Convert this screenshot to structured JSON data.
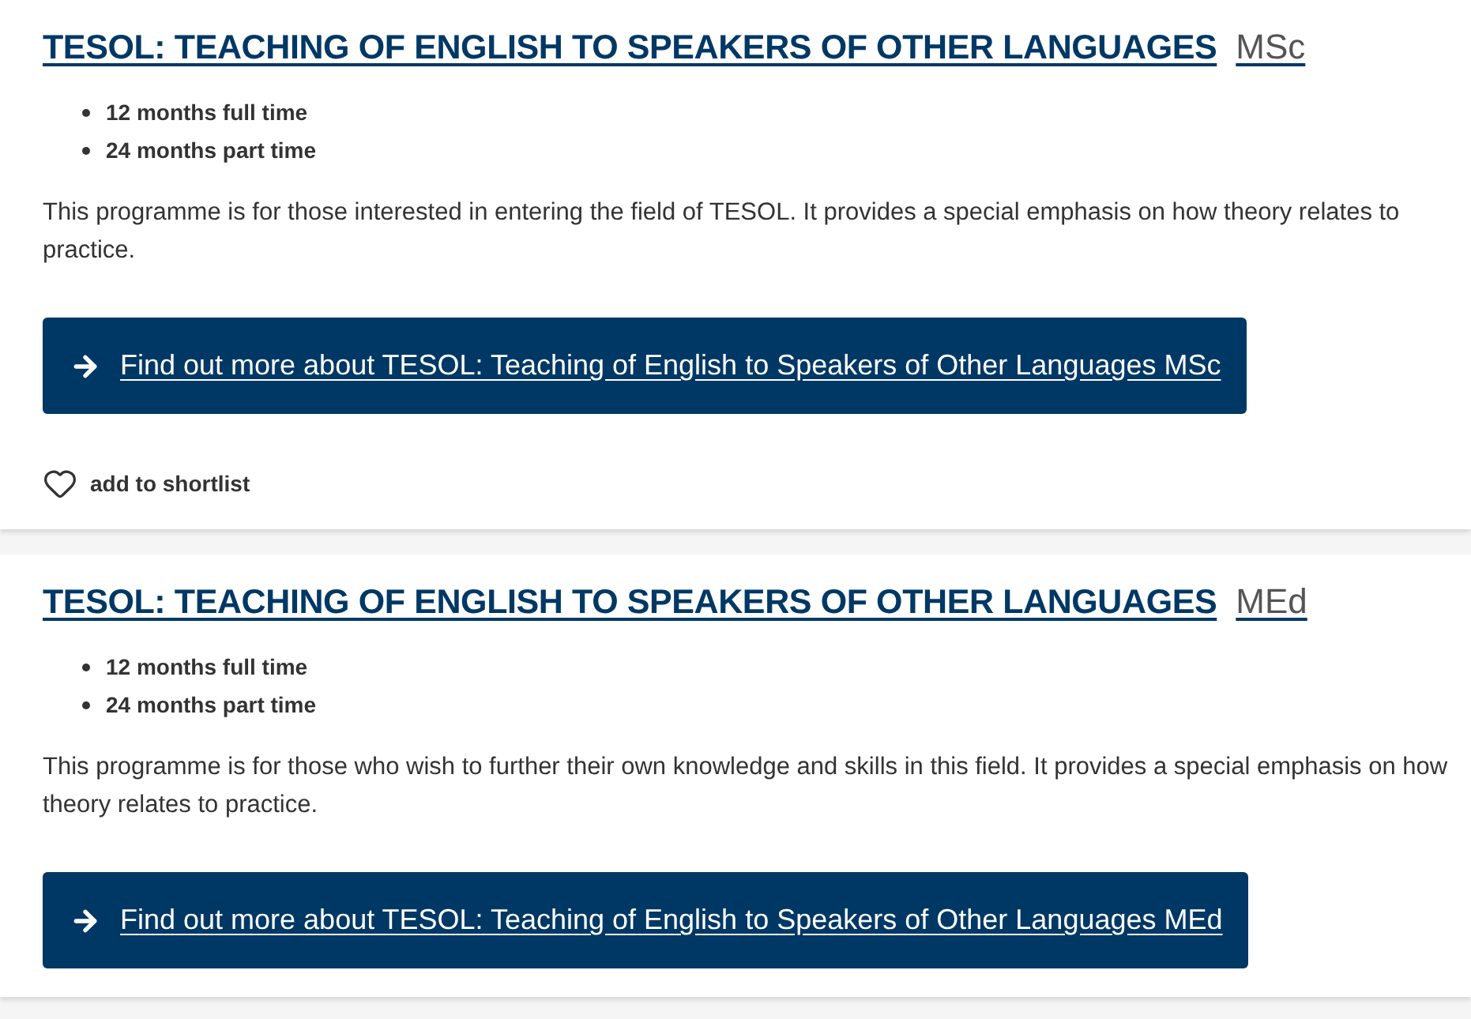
{
  "programmes": [
    {
      "title": "TESOL: TEACHING OF ENGLISH TO SPEAKERS OF OTHER LANGUAGES",
      "degree": "MSc",
      "durations": [
        "12 months full time",
        "24 months part time"
      ],
      "description": "This programme is for those interested in entering the field of TESOL. It provides a special emphasis on how theory relates to practice.",
      "button": {
        "label": "Find out more about TESOL: Teaching of English to Speakers of Other Languages MSc"
      },
      "shortlist": {
        "label": "add to shortlist",
        "shortlisted": false
      }
    },
    {
      "title": "TESOL: TEACHING OF ENGLISH TO SPEAKERS OF OTHER LANGUAGES",
      "degree": "MEd",
      "durations": [
        "12 months full time",
        "24 months part time"
      ],
      "description": "This programme is for those who wish to further their own knowledge and skills in this field. It provides a special emphasis on how theory relates to practice.",
      "button": {
        "label": "Find out more about TESOL: Teaching of English to Speakers of Other Languages MEd"
      }
    }
  ]
}
